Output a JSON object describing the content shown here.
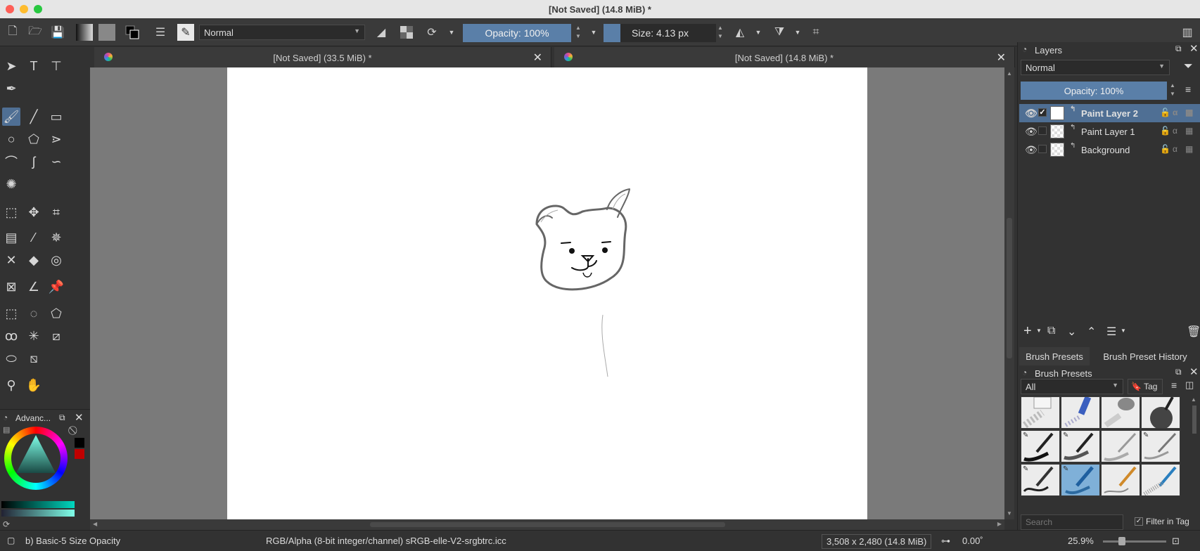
{
  "window": {
    "title": "[Not Saved]  (14.8 MiB) *",
    "traffic_colors": {
      "close": "#fe5f57",
      "minimize": "#febc2e",
      "zoom": "#28c840"
    }
  },
  "toolbar": {
    "blend_mode": "Normal",
    "opacity_label": "Opacity: 100%",
    "size_label": "Size: 4.13 px"
  },
  "tabs": [
    {
      "label": "[Not Saved]  (33.5 MiB) *"
    },
    {
      "label": "[Not Saved]  (14.8 MiB) *"
    }
  ],
  "color_docker": {
    "title": "Advanc..."
  },
  "layers_docker": {
    "title": "Layers",
    "blend_mode": "Normal",
    "opacity_label": "Opacity:  100%",
    "layers": [
      {
        "name": "Paint Layer 2",
        "selected": true,
        "checked": true
      },
      {
        "name": "Paint Layer 1",
        "selected": false,
        "checked": false
      },
      {
        "name": "Background",
        "selected": false,
        "checked": false
      }
    ]
  },
  "brush_tabs": {
    "presets": "Brush Presets",
    "history": "Brush Preset History"
  },
  "brush_presets_docker": {
    "title": "Brush Presets",
    "filter": "All",
    "tag_label": "Tag",
    "search_placeholder": "Search",
    "filter_in_tag": "Filter in Tag"
  },
  "status": {
    "brush": "b) Basic-5 Size Opacity",
    "color_space": "RGB/Alpha (8-bit integer/channel)  sRGB-elle-V2-srgbtrc.icc",
    "dimensions": "3,508 x 2,480 (14.8 MiB)",
    "rotation": "0.00˚",
    "zoom": "25.9%"
  },
  "colors": {
    "accent": "#4f6f94",
    "panel": "#323232",
    "canvas_bg": "#7a7a7a",
    "slider": "#5a7fa8"
  }
}
